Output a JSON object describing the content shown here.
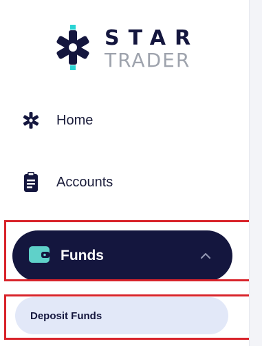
{
  "brand": {
    "name_top": "STAR",
    "name_bottom": "TRADER",
    "accent_color": "#2ad4d4",
    "dark_color": "#14163e"
  },
  "nav": {
    "items": [
      {
        "label": "Home",
        "icon": "star-burst-icon"
      },
      {
        "label": "Accounts",
        "icon": "clipboard-icon"
      },
      {
        "label": "Funds",
        "icon": "wallet-icon",
        "active": true,
        "expanded": true
      }
    ],
    "submenu": {
      "items": [
        {
          "label": "Deposit Funds"
        }
      ]
    }
  },
  "highlight_color": "#d8232a"
}
